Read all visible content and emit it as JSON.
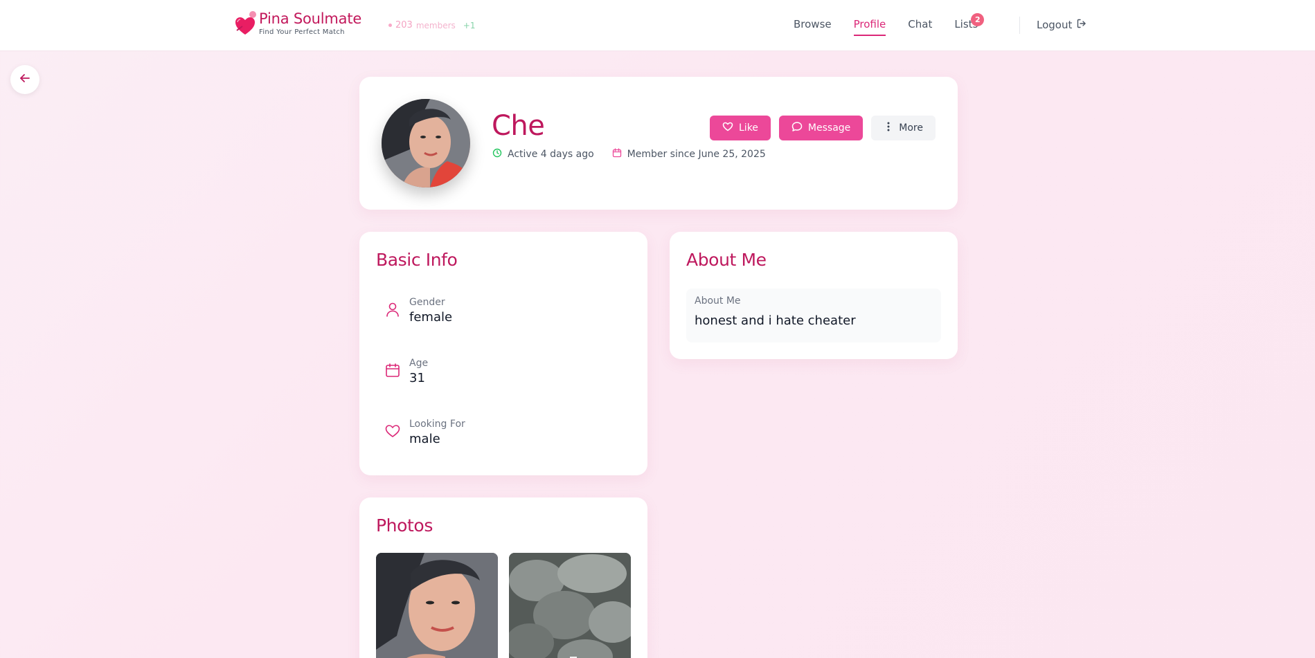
{
  "header": {
    "brand_name": "Pina Soulmate",
    "brand_tagline": "Find Your Perfect Match",
    "members_count": "203",
    "members_label": "members",
    "members_delta": "+1",
    "nav": [
      {
        "label": "Browse",
        "active": false
      },
      {
        "label": "Profile",
        "active": true
      },
      {
        "label": "Chat",
        "active": false
      },
      {
        "label": "Lists",
        "active": false,
        "badge": "2"
      }
    ],
    "logout_label": "Logout"
  },
  "profile": {
    "name": "Che",
    "active_status": "Active 4 days ago",
    "member_since": "Member since June 25, 2025",
    "actions": {
      "like": "Like",
      "message": "Message",
      "more": "More"
    }
  },
  "basic_info": {
    "title": "Basic Info",
    "rows": [
      {
        "label": "Gender",
        "value": "female",
        "icon": "person-icon"
      },
      {
        "label": "Age",
        "value": "31",
        "icon": "calendar-icon"
      },
      {
        "label": "Looking For",
        "value": "male",
        "icon": "heart-icon"
      }
    ]
  },
  "about": {
    "title": "About Me",
    "label": "About Me",
    "text": "honest and i hate cheater"
  },
  "photos": {
    "title": "Photos"
  },
  "colors": {
    "brand": "#be185d",
    "accent": "#ec4899",
    "online": "#22c55e",
    "badge": "#f0607f"
  }
}
